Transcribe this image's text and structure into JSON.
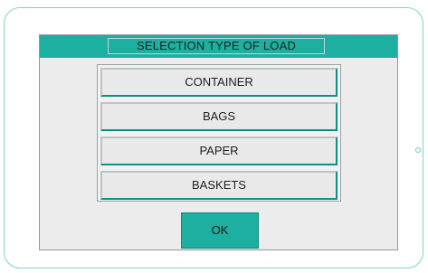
{
  "dialog": {
    "title": "SELECTION TYPE OF LOAD",
    "options": [
      {
        "label": "CONTAINER"
      },
      {
        "label": "BAGS"
      },
      {
        "label": "PAPER"
      },
      {
        "label": "BASKETS"
      }
    ],
    "ok_label": "OK"
  },
  "colors": {
    "accent": "#1daf9f",
    "frame": "#7fd3cb",
    "panel": "#ececec"
  }
}
